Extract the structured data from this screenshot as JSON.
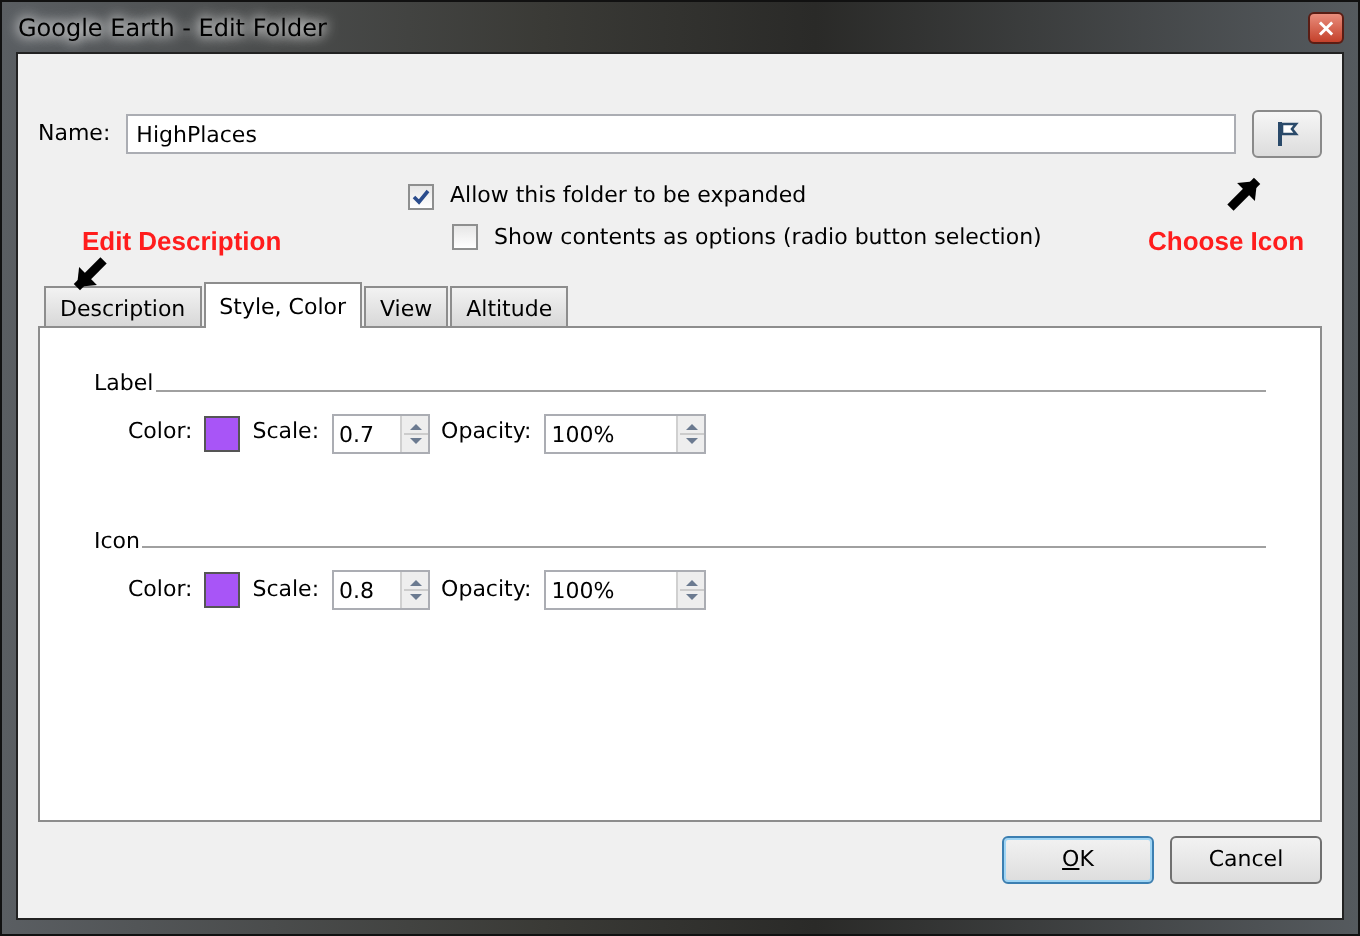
{
  "window": {
    "title": "Google Earth - Edit Folder",
    "close": "×"
  },
  "name_field": {
    "label": "Name:",
    "value": "HighPlaces"
  },
  "options": [
    {
      "label": "Allow this folder to be expanded",
      "checked": true,
      "indented": false
    },
    {
      "label": "Show contents as options (radio button selection)",
      "checked": false,
      "indented": true
    }
  ],
  "annotations": [
    {
      "text": "Edit Description",
      "kind": "down"
    },
    {
      "text": "Choose Icon",
      "kind": "up"
    }
  ],
  "tabs": [
    {
      "label": "Description",
      "selected": false
    },
    {
      "label": "Style, Color",
      "selected": true
    },
    {
      "label": "View",
      "selected": false
    },
    {
      "label": "Altitude",
      "selected": false
    }
  ],
  "groups": [
    {
      "title": "Label",
      "color_label": "Color:",
      "color": "#a855f7",
      "scale_label": "Scale:",
      "scale": "0.7",
      "opacity_label": "Opacity:",
      "opacity": "100%"
    },
    {
      "title": "Icon",
      "color_label": "Color:",
      "color": "#a855f7",
      "scale_label": "Scale:",
      "scale": "0.8",
      "opacity_label": "Opacity:",
      "opacity": "100%"
    }
  ],
  "buttons": [
    {
      "label": "OK",
      "default": true,
      "access_key": true
    },
    {
      "label": "Cancel",
      "default": false,
      "access_key": false
    }
  ]
}
